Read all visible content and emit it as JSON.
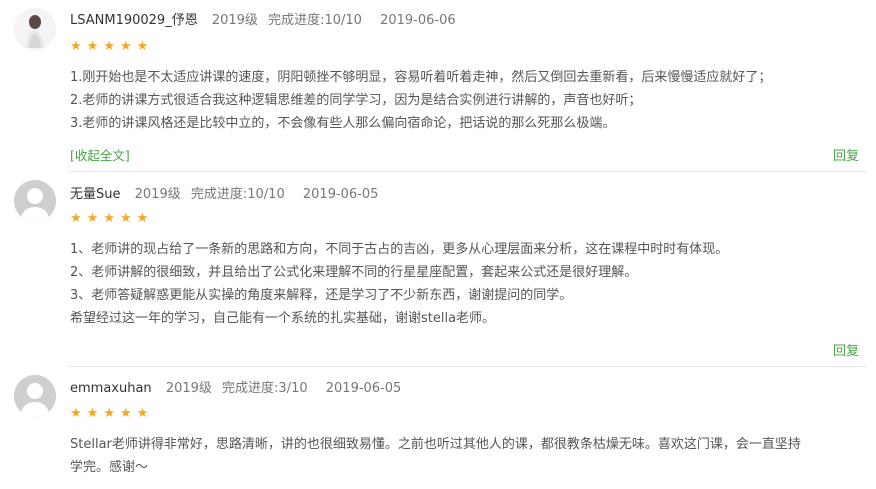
{
  "reviews": [
    {
      "username": "LSANM190029_伃恩",
      "grade": "2019级",
      "progress": "完成进度:10/10",
      "date": "2019-06-06",
      "rating": 5,
      "lines": [
        "1.刚开始也是不太适应讲课的速度，阴阳顿挫不够明显，容易听着听着走神，然后又倒回去重新看，后来慢慢适应就好了；",
        "2.老师的讲课方式很适合我这种逻辑思维差的同学学习，因为是结合实例进行讲解的，声音也好听；",
        "3.老师的讲课风格还是比较中立的，不会像有些人那么偏向宿命论，把话说的那么死那么极端。"
      ],
      "collapse_label": "[收起全文]",
      "reply_label": "回复",
      "avatar": "person-photo"
    },
    {
      "username": "无量Sue",
      "grade": "2019级",
      "progress": "完成进度:10/10",
      "date": "2019-06-05",
      "rating": 5,
      "lines": [
        "1、老师讲的现占给了一条新的思路和方向，不同于古占的吉凶，更多从心理层面来分析，这在课程中时时有体现。",
        "2、老师讲解的很细致，并且给出了公式化来理解不同的行星星座配置，套起来公式还是很好理解。",
        "3、老师答疑解惑更能从实操的角度来解释，还是学习了不少新东西，谢谢提问的同学。",
        "希望经过这一年的学习，自己能有一个系统的扎实基础，谢谢stella老师。"
      ],
      "reply_label": "回复",
      "avatar": "default-avatar"
    },
    {
      "username": "emmaxuhan",
      "grade": "2019级",
      "progress": "完成进度:3/10",
      "date": "2019-06-05",
      "rating": 5,
      "lines": [
        "Stellar老师讲得非常好，思路清晰，讲的也很细致易懂。之前也听过其他人的课，都很教条枯燥无味。喜欢这门课，会一直坚持",
        "学完。感谢～"
      ],
      "avatar": "default-avatar"
    }
  ],
  "star_glyph": "★",
  "colors": {
    "star": "#f5a623",
    "link": "#45a645",
    "meta": "#777777",
    "text": "#555555"
  }
}
